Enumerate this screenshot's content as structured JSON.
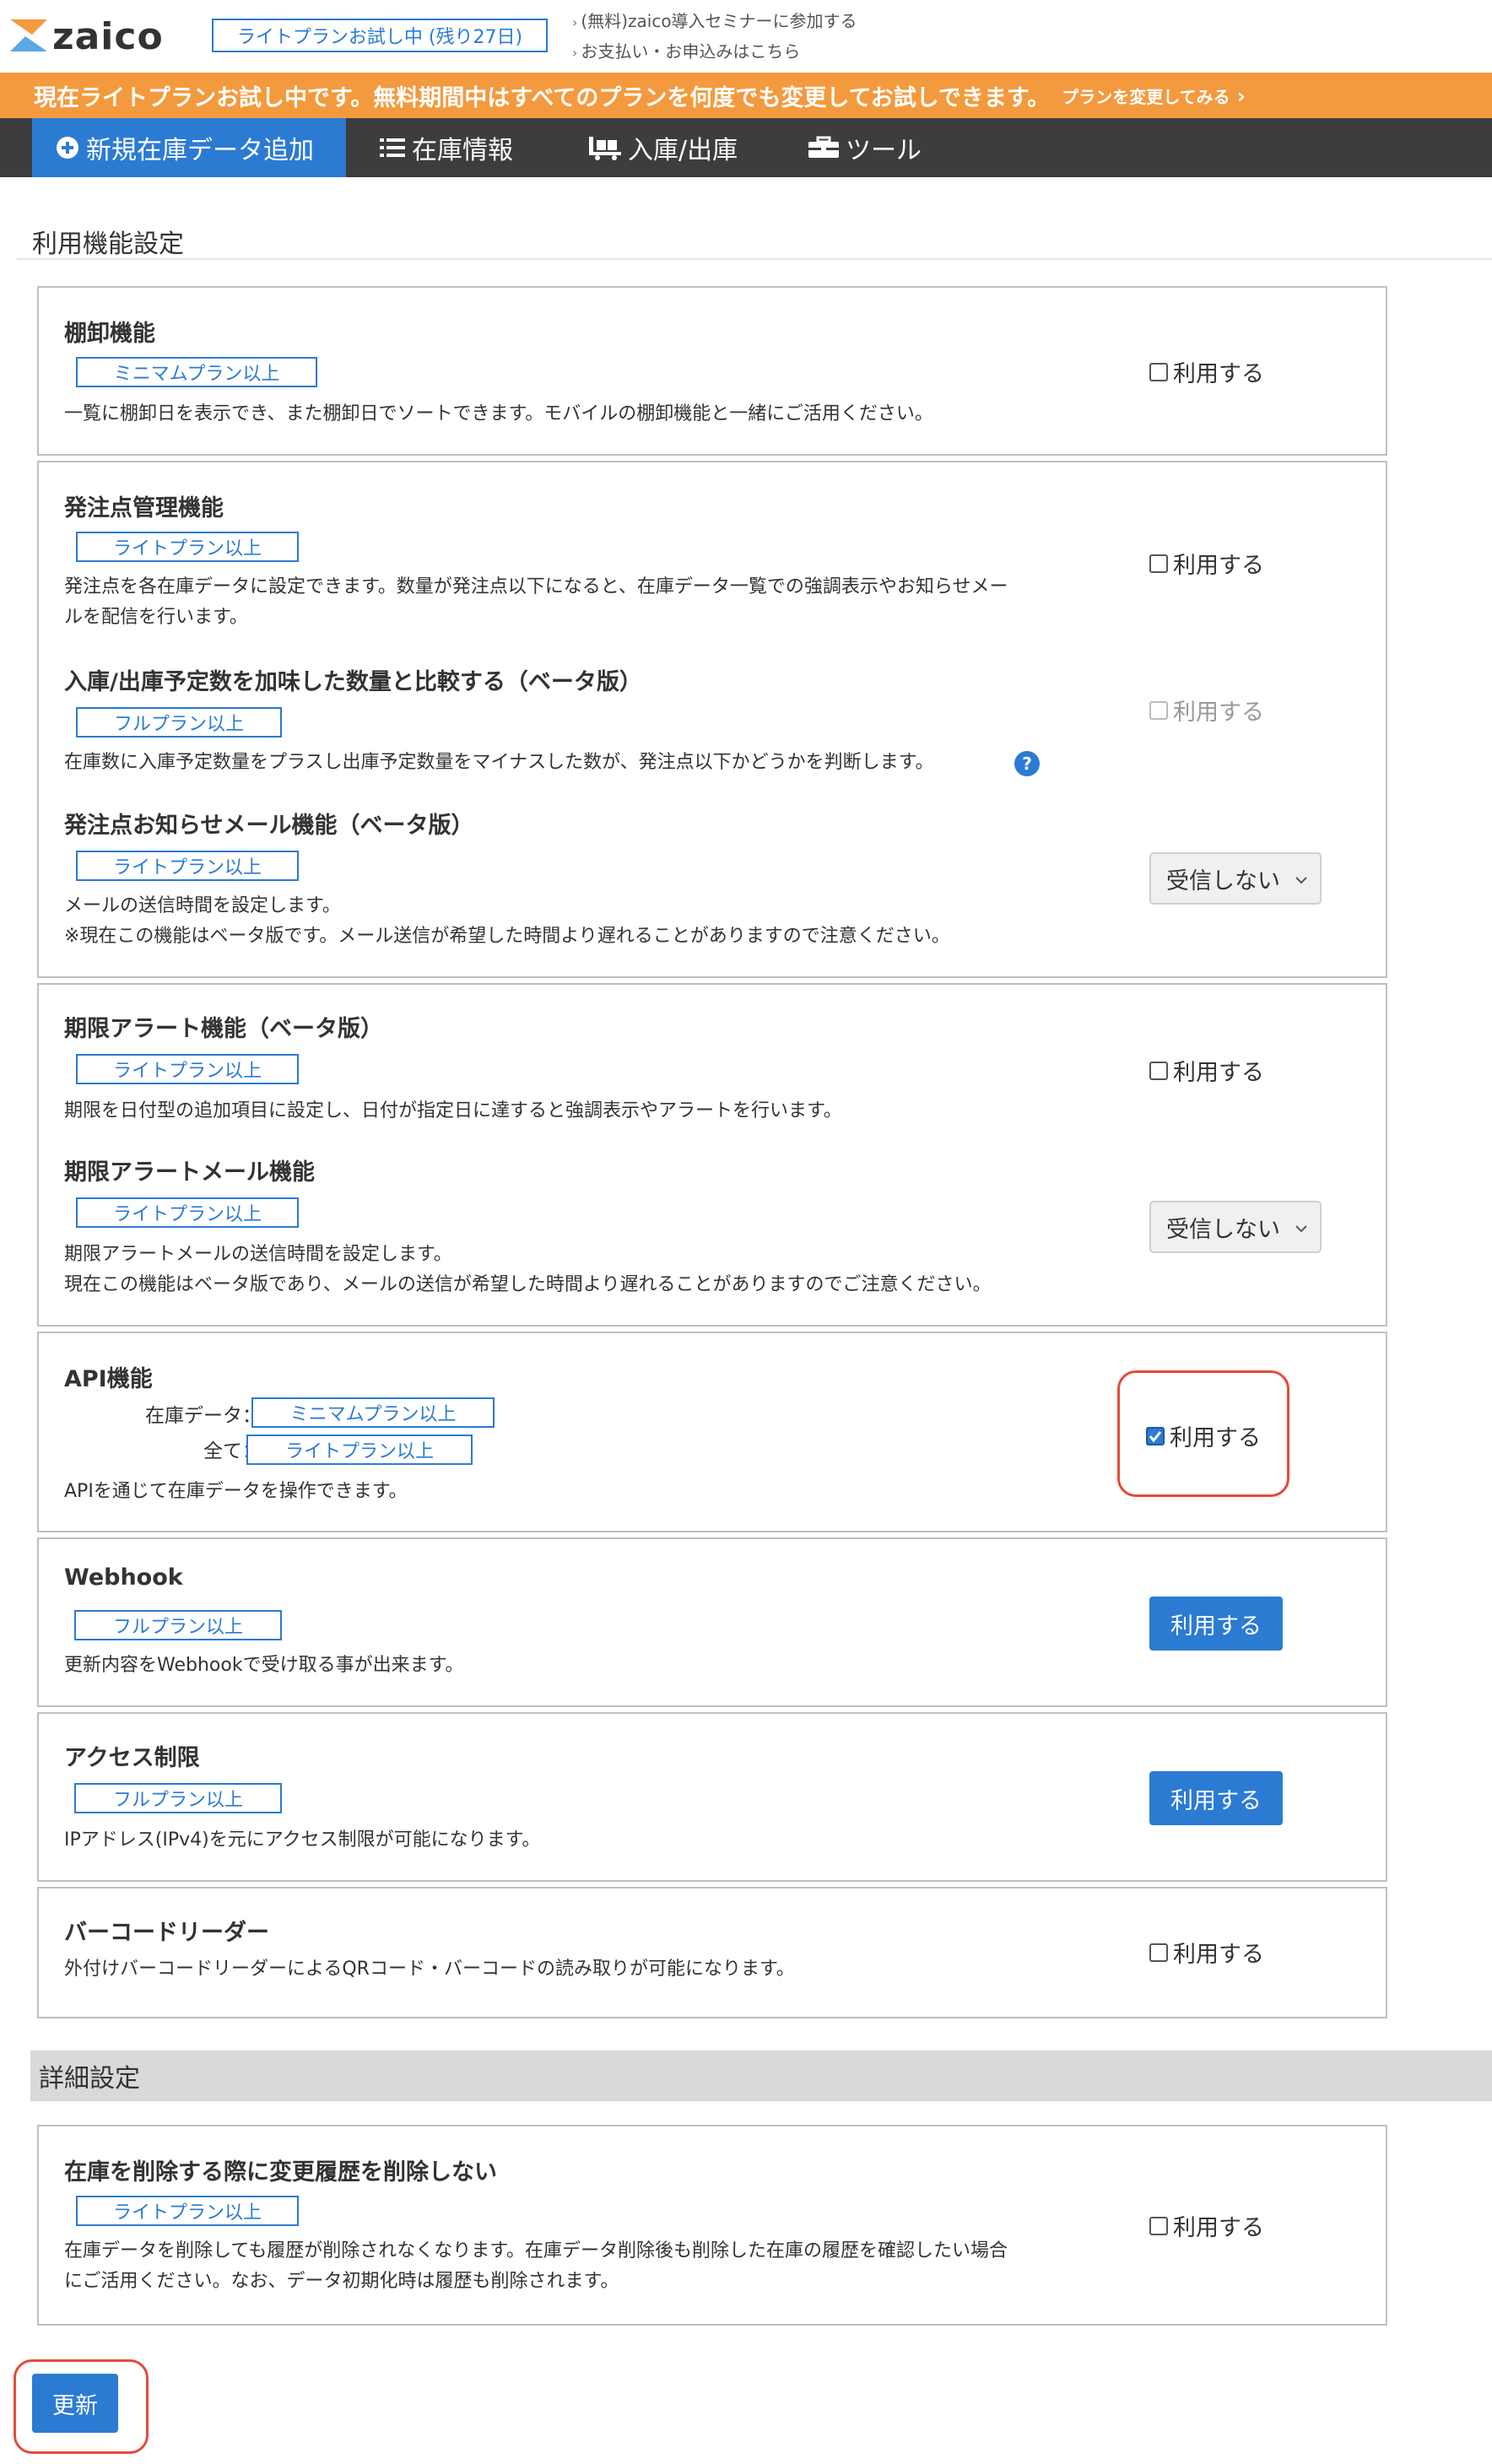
{
  "header": {
    "logo_text": "zaico",
    "trial_badge": "ライトプランお試し中 (残り27日)",
    "links": [
      "(無料)zaico導入セミナーに参加する",
      "お支払い・お申込みはこちら"
    ]
  },
  "banner": {
    "text": "現在ライトプランお試し中です。無料期間中はすべてのプランを何度でも変更してお試しできます。",
    "link": "プランを変更してみる"
  },
  "nav": {
    "items": [
      {
        "label": "新規在庫データ追加",
        "icon": "plus-circle-icon"
      },
      {
        "label": "在庫情報",
        "icon": "list-icon"
      },
      {
        "label": "入庫/出庫",
        "icon": "dolly-icon"
      },
      {
        "label": "ツール",
        "icon": "toolbox-icon"
      }
    ]
  },
  "section1": {
    "title": "利用機能設定"
  },
  "labels": {
    "use": "利用する",
    "not_receive": "受信しない"
  },
  "features": {
    "tanaoroshi": {
      "title": "棚卸機能",
      "plan": "ミニマムプラン以上",
      "desc": "一覧に棚卸日を表示でき、また棚卸日でソートできます。モバイルの棚卸機能と一緒にご活用ください。"
    },
    "reorder": {
      "title": "発注点管理機能",
      "plan": "ライトプラン以上",
      "desc1": "発注点を各在庫データに設定できます。数量が発注点以下になると、在庫データ一覧での強調表示やお知らせメー",
      "desc2": "ルを配信を行います。"
    },
    "planned": {
      "title": "入庫/出庫予定数を加味した数量と比較する（ベータ版）",
      "plan": "フルプラン以上",
      "desc": "在庫数に入庫予定数量をプラスし出庫予定数量をマイナスした数が、発注点以下かどうかを判断します。",
      "help": "?"
    },
    "reorder_mail": {
      "title": "発注点お知らせメール機能（ベータ版）",
      "plan": "ライトプラン以上",
      "desc1": "メールの送信時間を設定します。",
      "desc2": "※現在この機能はベータ版です。メール送信が希望した時間より遅れることがありますので注意ください。"
    },
    "expiry": {
      "title": "期限アラート機能（ベータ版）",
      "plan": "ライトプラン以上",
      "desc": "期限を日付型の追加項目に設定し、日付が指定日に達すると強調表示やアラートを行います。"
    },
    "expiry_mail": {
      "title": "期限アラートメール機能",
      "plan": "ライトプラン以上",
      "desc1": "期限アラートメールの送信時間を設定します。",
      "desc2": "現在この機能はベータ版であり、メールの送信が希望した時間より遅れることがありますのでご注意ください。"
    },
    "api": {
      "title": "API機能",
      "label1": "在庫データ：",
      "plan1": "ミニマムプラン以上",
      "label2": "全て：",
      "plan2": "ライトプラン以上",
      "desc": "APIを通じて在庫データを操作できます。"
    },
    "webhook": {
      "title": "Webhook",
      "plan": "フルプラン以上",
      "desc": "更新内容をWebhookで受け取る事が出来ます。"
    },
    "access": {
      "title": "アクセス制限",
      "plan": "フルプラン以上",
      "desc": "IPアドレス(IPv4)を元にアクセス制限が可能になります。"
    },
    "barcode": {
      "title": "バーコードリーダー",
      "desc": "外付けバーコードリーダーによるQRコード・バーコードの読み取りが可能になります。"
    }
  },
  "section2": {
    "title": "詳細設定"
  },
  "history": {
    "title": "在庫を削除する際に変更履歴を削除しない",
    "plan": "ライトプラン以上",
    "desc1": "在庫データを削除しても履歴が削除されなくなります。在庫データ削除後も削除した在庫の履歴を確認したい場合",
    "desc2": "にご活用ください。なお、データ初期化時は履歴も削除されます。"
  },
  "update_button": "更新",
  "colors": {
    "primary": "#2b7bd3",
    "banner": "#f39a3e",
    "nav": "#3d3d3d",
    "highlight": "#e24c3a"
  }
}
